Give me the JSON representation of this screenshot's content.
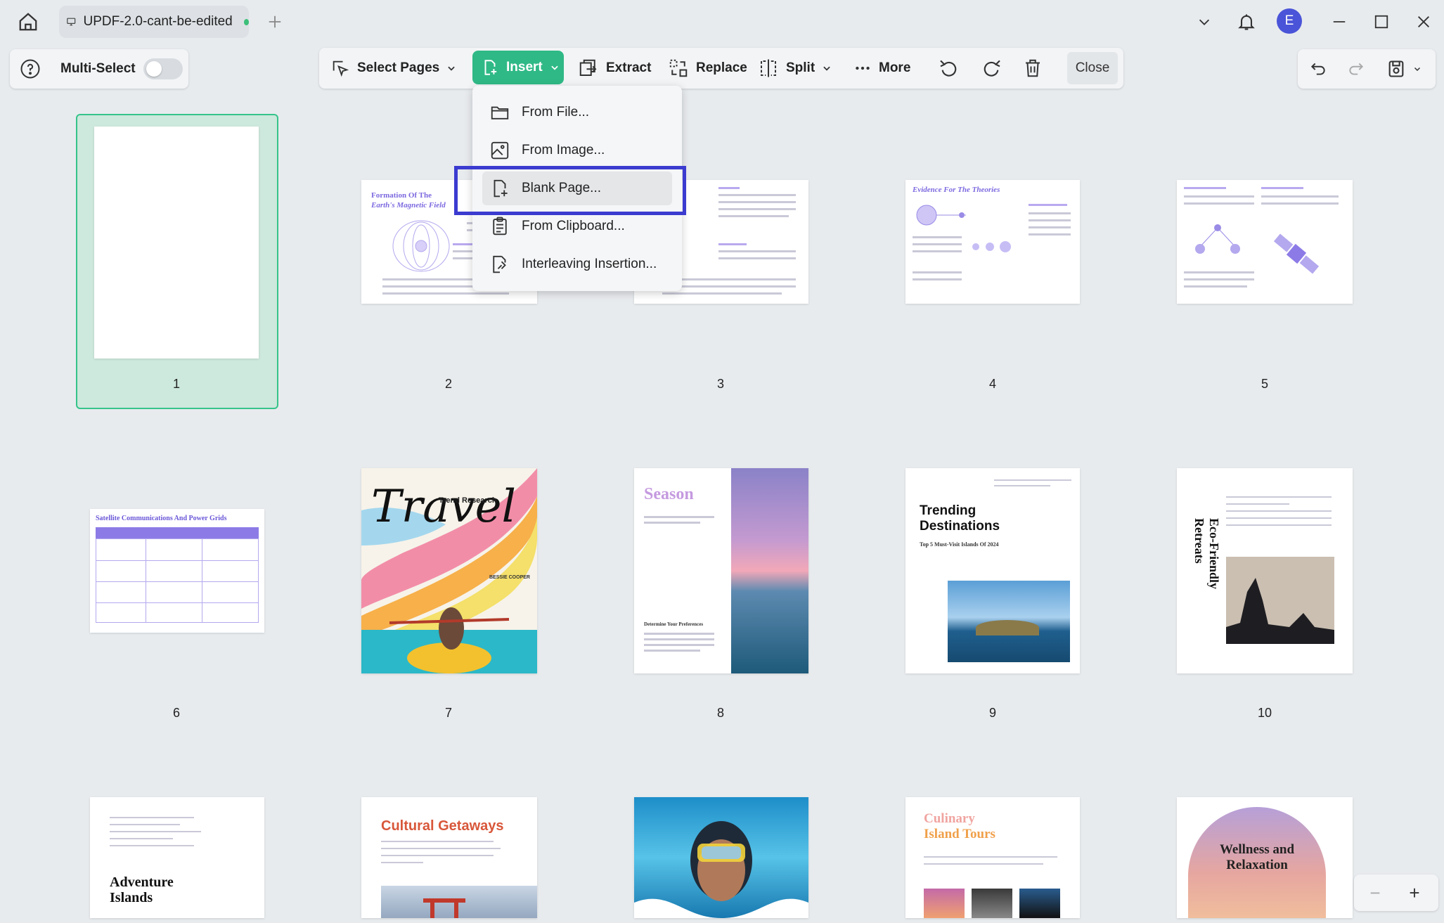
{
  "titlebar": {
    "tab_title": "UPDF-2.0-cant-be-edited",
    "avatar_letter": "E",
    "icons": [
      "home-icon",
      "monitor-icon",
      "plus-icon",
      "chevron-down-icon",
      "bell-icon",
      "minimize-icon",
      "maximize-icon",
      "close-icon"
    ]
  },
  "left_panel": {
    "multi_select_label": "Multi-Select",
    "multi_select_on": false
  },
  "toolbar": {
    "select_pages": "Select Pages",
    "insert": "Insert",
    "extract": "Extract",
    "replace": "Replace",
    "split": "Split",
    "more": "More",
    "close": "Close"
  },
  "insert_menu": {
    "items": [
      "From File...",
      "From Image...",
      "Blank Page...",
      "From Clipboard...",
      "Interleaving Insertion..."
    ],
    "highlighted": "Blank Page..."
  },
  "pages": {
    "numbers": [
      "1",
      "2",
      "3",
      "4",
      "5",
      "6",
      "7",
      "8",
      "9",
      "10"
    ],
    "p2_title_1": "Formation Of The",
    "p2_title_2": "Earth's Magnetic Field",
    "p4_title": "Evidence For The Theories",
    "p6_title": "Satellite Communications And Power Grids",
    "p7_title": "Travel",
    "p7_sub": "Trend Research",
    "p7_author": "BESSIE COOPER",
    "p8_title": "Season",
    "p8_sub": "Determine Your Preferences",
    "p9_title": "Trending Destinations",
    "p9_sub": "Top 5 Must-Visit Islands Of 2024",
    "p10_title": "Eco-Friendly Retreats",
    "p11_title": "Adventure Islands",
    "p12_title": "Cultural Getaways",
    "p14_title_1": "Culinary",
    "p14_title_2": "Island Tours",
    "p15_title": "Wellness and Relaxation"
  },
  "zoom": {
    "minus": "−",
    "plus": "+"
  },
  "colors": {
    "accent": "#2fb986",
    "highlight_box": "#3b3bd0",
    "avatar": "#4a54d8"
  }
}
